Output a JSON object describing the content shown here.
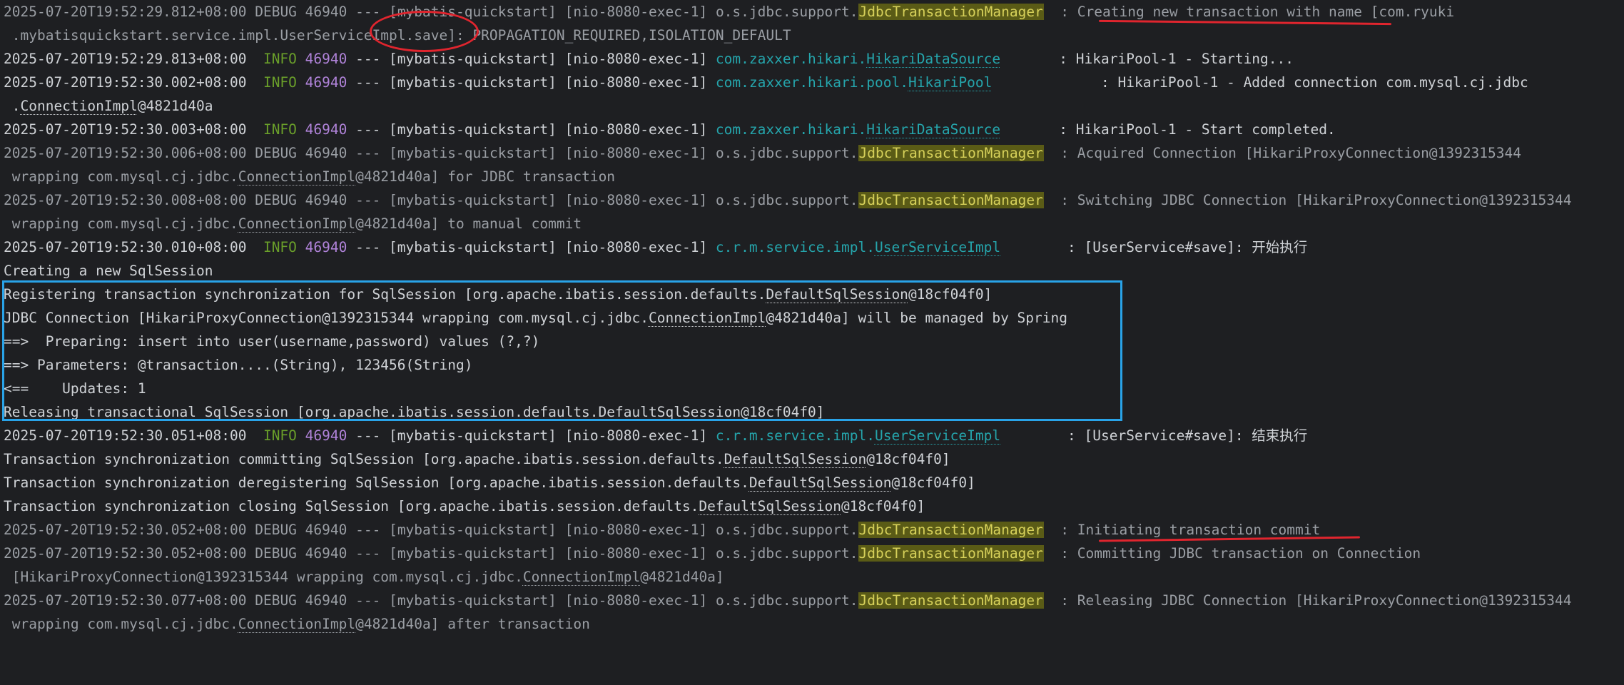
{
  "colors": {
    "background": "#1e1f22",
    "text": "#cfd2d6",
    "debug": "#9a9ea4",
    "info": "#6a9f2a",
    "pid": "#b083d9",
    "logger_class": "#25a5ac",
    "highlight_bg": "#5a5b16",
    "box": "#29a3e8",
    "marker": "#e0252e"
  },
  "log": {
    "l1": {
      "ts": "2025-07-20T19:52:29.812+08:00",
      "lvl": "DEBUG",
      "pid": "46940",
      "thread": " --- [mybatis-quickstart] [nio-8080-exec-1] ",
      "pkg": "o.s.jdbc.support.",
      "cls": "JdbcTransactionManager",
      "sep": "  : ",
      "msg_a": "Creating new transaction with name",
      "msg_b": " [com.ryuki"
    },
    "l1b": {
      "text": " .mybatisquickstart.service.impl.UserServiceImpl.save]: PROPAGATION_REQUIRED,ISOLATION_DEFAULT"
    },
    "l2": {
      "ts": "2025-07-20T19:52:29.813+08:00",
      "lvl": "  INFO ",
      "pid": "46940",
      "thread": " --- [mybatis-quickstart] [nio-8080-exec-1] ",
      "pkg": "com.zaxxer.hikari.",
      "cls": "HikariDataSource",
      "sep": "       : ",
      "msg": "HikariPool-1 - Starting..."
    },
    "l3": {
      "ts": "2025-07-20T19:52:30.002+08:00",
      "lvl": "  INFO ",
      "pid": "46940",
      "thread": " --- [mybatis-quickstart] [nio-8080-exec-1] ",
      "pkg": "com.zaxxer.hikari.pool.",
      "cls": "HikariPool",
      "sep": "             : ",
      "msg": "HikariPool-1 - Added connection com.mysql.cj.jdbc"
    },
    "l3b": {
      "pre": " .",
      "cls": "ConnectionImpl",
      "post": "@4821d40a"
    },
    "l4": {
      "ts": "2025-07-20T19:52:30.003+08:00",
      "lvl": "  INFO ",
      "pid": "46940",
      "thread": " --- [mybatis-quickstart] [nio-8080-exec-1] ",
      "pkg": "com.zaxxer.hikari.",
      "cls": "HikariDataSource",
      "sep": "       : ",
      "msg": "HikariPool-1 - Start completed."
    },
    "l5": {
      "ts": "2025-07-20T19:52:30.006+08:00",
      "lvl": "DEBUG",
      "pid": "46940",
      "thread": " --- [mybatis-quickstart] [nio-8080-exec-1] ",
      "pkg": "o.s.jdbc.support.",
      "cls": "JdbcTransactionManager",
      "sep": "  : ",
      "msg": "Acquired Connection [HikariProxyConnection@1392315344"
    },
    "l5b": {
      "pre": " wrapping com.mysql.cj.jdbc.",
      "cls": "ConnectionImpl",
      "post": "@4821d40a] for JDBC transaction"
    },
    "l6": {
      "ts": "2025-07-20T19:52:30.008+08:00",
      "lvl": "DEBUG",
      "pid": "46940",
      "thread": " --- [mybatis-quickstart] [nio-8080-exec-1] ",
      "pkg": "o.s.jdbc.support.",
      "cls": "JdbcTransactionManager",
      "sep": "  : ",
      "msg": "Switching JDBC Connection [HikariProxyConnection@1392315344"
    },
    "l6b": {
      "pre": " wrapping com.mysql.cj.jdbc.",
      "cls": "ConnectionImpl",
      "post": "@4821d40a] to manual commit"
    },
    "l7": {
      "ts": "2025-07-20T19:52:30.010+08:00",
      "lvl": "  INFO ",
      "pid": "46940",
      "thread": " --- [mybatis-quickstart] [nio-8080-exec-1] ",
      "pkg": "c.r.m.service.impl.",
      "cls": "UserServiceImpl",
      "sep": "        : ",
      "msg": "[UserService#save]: 开始执行"
    },
    "l8": {
      "text": "Creating a new SqlSession"
    },
    "l9": {
      "pre": "Registering transaction synchronization for SqlSession [org.apache.ibatis.session.defaults.",
      "cls": "DefaultSqlSession",
      "post": "@18cf04f0]"
    },
    "l10": {
      "pre": "JDBC Connection [HikariProxyConnection@1392315344 wrapping com.mysql.cj.jdbc.",
      "cls": "ConnectionImpl",
      "post": "@4821d40a] will be managed by Spring"
    },
    "l11": {
      "text": "==>  Preparing: insert into user(username,password) values (?,?)"
    },
    "l12": {
      "text": "==> Parameters: @transaction....(String), 123456(String)"
    },
    "l13": {
      "text": "<==    Updates: 1"
    },
    "l14": {
      "pre": "Releasing transactional SqlSession [org.apache.ibatis.session.defaults.",
      "cls": "DefaultSqlSession",
      "post": "@18cf04f0]"
    },
    "l15": {
      "ts": "2025-07-20T19:52:30.051+08:00",
      "lvl": "  INFO ",
      "pid": "46940",
      "thread": " --- [mybatis-quickstart] [nio-8080-exec-1] ",
      "pkg": "c.r.m.service.impl.",
      "cls": "UserServiceImpl",
      "sep": "        : ",
      "msg": "[UserService#save]: 结束执行"
    },
    "l16": {
      "pre": "Transaction synchronization committing SqlSession [org.apache.ibatis.session.defaults.",
      "cls": "DefaultSqlSession",
      "post": "@18cf04f0]"
    },
    "l17": {
      "pre": "Transaction synchronization deregistering SqlSession [org.apache.ibatis.session.defaults.",
      "cls": "DefaultSqlSession",
      "post": "@18cf04f0]"
    },
    "l18": {
      "pre": "Transaction synchronization closing SqlSession [org.apache.ibatis.session.defaults.",
      "cls": "DefaultSqlSession",
      "post": "@18cf04f0]"
    },
    "l19": {
      "ts": "2025-07-20T19:52:30.052+08:00",
      "lvl": "DEBUG",
      "pid": "46940",
      "thread": " --- [mybatis-quickstart] [nio-8080-exec-1] ",
      "pkg": "o.s.jdbc.support.",
      "cls": "JdbcTransactionManager",
      "sep": "  : ",
      "msg": "Initiating transaction commit"
    },
    "l20": {
      "ts": "2025-07-20T19:52:30.052+08:00",
      "lvl": "DEBUG",
      "pid": "46940",
      "thread": " --- [mybatis-quickstart] [nio-8080-exec-1] ",
      "pkg": "o.s.jdbc.support.",
      "cls": "JdbcTransactionManager",
      "sep": "  : ",
      "msg": "Committing JDBC transaction on Connection"
    },
    "l20b": {
      "pre": " [HikariProxyConnection@1392315344 wrapping com.mysql.cj.jdbc.",
      "cls": "ConnectionImpl",
      "post": "@4821d40a]"
    },
    "l21": {
      "ts": "2025-07-20T19:52:30.077+08:00",
      "lvl": "DEBUG",
      "pid": "46940",
      "thread": " --- [mybatis-quickstart] [nio-8080-exec-1] ",
      "pkg": "o.s.jdbc.support.",
      "cls": "JdbcTransactionManager",
      "sep": "  : ",
      "msg": "Releasing JDBC Connection [HikariProxyConnection@1392315344"
    },
    "l21b": {
      "pre": " wrapping com.mysql.cj.jdbc.",
      "cls": "ConnectionImpl",
      "post": "@4821d40a] after transaction"
    }
  }
}
